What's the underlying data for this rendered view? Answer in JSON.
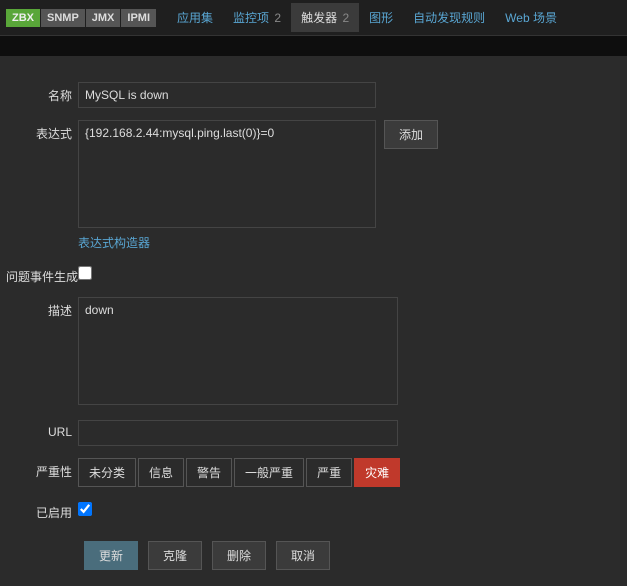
{
  "protocols": {
    "zbx": "ZBX",
    "snmp": "SNMP",
    "jmx": "JMX",
    "ipmi": "IPMI"
  },
  "tabs": {
    "apps": "应用集",
    "items": {
      "label": "监控项",
      "count": "2"
    },
    "triggers": {
      "label": "触发器",
      "count": "2"
    },
    "graphs": "图形",
    "discovery": "自动发现规则",
    "web": "Web 场景"
  },
  "labels": {
    "name": "名称",
    "expression": "表达式",
    "problem_gen": "问题事件生成",
    "description": "描述",
    "url": "URL",
    "severity": "严重性",
    "enabled": "已启用"
  },
  "values": {
    "name": "MySQL is down",
    "expression": "{192.168.2.44:mysql.ping.last(0)}=0",
    "description": "down",
    "url": "",
    "problem_gen_checked": false,
    "enabled_checked": true
  },
  "buttons": {
    "add": "添加",
    "expr_constructor": "表达式构造器",
    "update": "更新",
    "clone": "克隆",
    "delete": "删除",
    "cancel": "取消"
  },
  "severity": {
    "options": [
      "未分类",
      "信息",
      "警告",
      "一般严重",
      "严重",
      "灾难"
    ],
    "selected_index": 5
  }
}
